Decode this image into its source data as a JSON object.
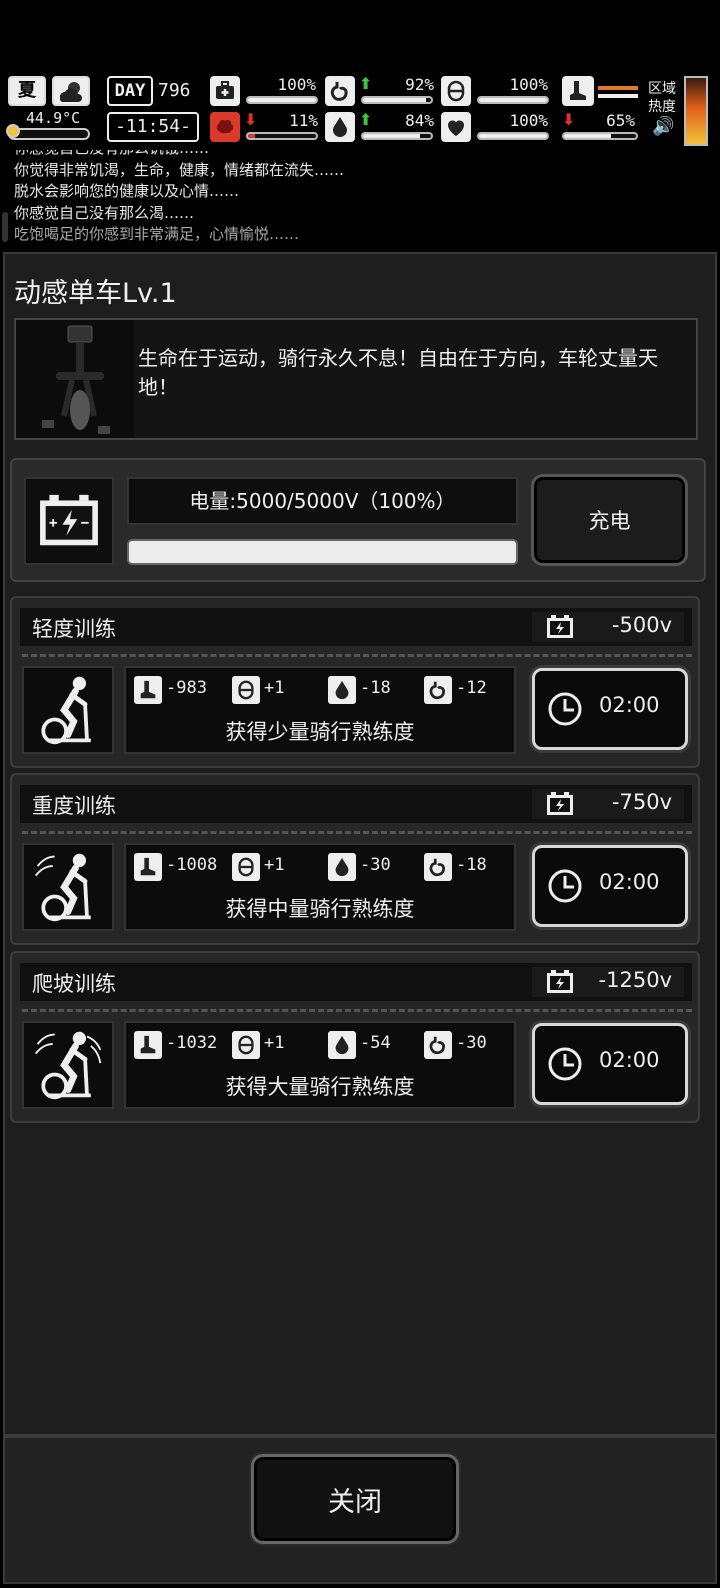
{
  "hud": {
    "season": "夏",
    "weather_icon": "cloudy-sun-icon",
    "temperature": "44.9°C",
    "temperature_level": 0.05,
    "day_label": "DAY",
    "day_number": "796",
    "clock": "-11:54-",
    "stats": {
      "health": {
        "value": "100%",
        "level": 1.0
      },
      "satiety": {
        "value": "92%",
        "level": 0.92,
        "trend": "up"
      },
      "energy": {
        "value": "100%",
        "level": 1.0
      },
      "mental": {
        "value": "11%",
        "level": 0.11,
        "trend": "down"
      },
      "hydration": {
        "value": "84%",
        "level": 0.84,
        "trend": "up"
      },
      "mood": {
        "value": "100%",
        "level": 1.0
      },
      "stamina": {
        "value": "65%",
        "level": 0.65,
        "trend": "down"
      }
    },
    "region_heat_label": "区域热度"
  },
  "messages": [
    "你感觉自己没有那么饥饿……",
    "你觉得非常饥渴，生命，健康，情绪都在流失……",
    "脱水会影响您的健康以及心情……",
    "你感觉自己没有那么渴……",
    "吃饱喝足的你感到非常满足，心情愉悦……"
  ],
  "item": {
    "title": "动感单车Lv.1",
    "description": "生命在于运动，骑行永久不息！自由在于方向，车轮丈量天地！"
  },
  "power": {
    "label": "电量:5000/5000V（100%）",
    "level": 1.0,
    "charge_button": "充电"
  },
  "trainings": [
    {
      "name": "轻度训练",
      "cost": "-500v",
      "effects": {
        "stamina": "-983",
        "energy": "+1",
        "hydration": "-18",
        "satiety": "-12"
      },
      "gain": "获得少量骑行熟练度",
      "duration": "02:00"
    },
    {
      "name": "重度训练",
      "cost": "-750v",
      "effects": {
        "stamina": "-1008",
        "energy": "+1",
        "hydration": "-30",
        "satiety": "-18"
      },
      "gain": "获得中量骑行熟练度",
      "duration": "02:00"
    },
    {
      "name": "爬坡训练",
      "cost": "-1250v",
      "effects": {
        "stamina": "-1032",
        "energy": "+1",
        "hydration": "-54",
        "satiety": "-30"
      },
      "gain": "获得大量骑行熟练度",
      "duration": "02:00"
    }
  ],
  "close_button": "关闭"
}
